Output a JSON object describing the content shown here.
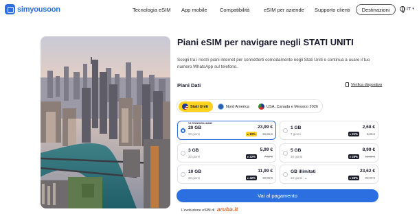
{
  "header": {
    "logo_text": "simyousoon",
    "nav": [
      "Tecnologia eSIM",
      "App mobile",
      "Compatibilità",
      "eSIM per aziende",
      "Supporto clienti"
    ],
    "destinations_button": "Destinazioni",
    "language": "IT",
    "language_chevron": "▾"
  },
  "hero": {
    "title": "Piani eSIM per navigare negli STATI UNITI",
    "description": "Scegli tra i nostri piani internet per connetterti comodamente negli Stati Uniti e continua a usare il tuo numero WhatsApp sul telefono."
  },
  "plans": {
    "heading": "Piani Dati",
    "verify_link": "Verifica dispositivo",
    "tabs": [
      {
        "label": "Stati Uniti",
        "active": true
      },
      {
        "label": "Nord America",
        "active": false
      },
      {
        "label": "USA, Canada e Messico 2026",
        "active": false
      }
    ],
    "recommended_label": "VI CONSIGLIAMO",
    "cards": [
      {
        "data": "20 GB",
        "duration": "30 giorni",
        "price": "23,99 €",
        "discount": "10%",
        "old_price": "26,55 €",
        "selected": true,
        "badge_style": "yellow"
      },
      {
        "data": "1 GB",
        "duration": "7 giorni",
        "price": "2,68 €",
        "discount": "21%",
        "old_price": "3,39 €",
        "selected": false,
        "badge_style": "dark"
      },
      {
        "data": "3 GB",
        "duration": "30 giorni",
        "price": "5,99 €",
        "discount": "22%",
        "old_price": "7,69 €",
        "selected": false,
        "badge_style": "dark"
      },
      {
        "data": "5 GB",
        "duration": "30 giorni",
        "price": "8,99 €",
        "discount": "25%",
        "old_price": "11,99 €",
        "selected": false,
        "badge_style": "dark"
      },
      {
        "data": "10 GB",
        "duration": "30 giorni",
        "price": "11,99 €",
        "discount": "42%",
        "old_price": "20,69 €",
        "selected": false,
        "badge_style": "dark"
      },
      {
        "data": "GB illimitati",
        "duration": "10 giorni",
        "price": "23,62 €",
        "discount": "25%",
        "old_price": "31,49 €",
        "selected": false,
        "badge_style": "dark"
      }
    ]
  },
  "cta": {
    "label": "Vai al pagamento"
  },
  "footer": {
    "note": "L'evoluzione eSIM di",
    "brand": "aruba.it"
  },
  "colors": {
    "accent": "#2b6fe0",
    "highlight": "#ffd21f",
    "brand_orange": "#e5662a"
  }
}
